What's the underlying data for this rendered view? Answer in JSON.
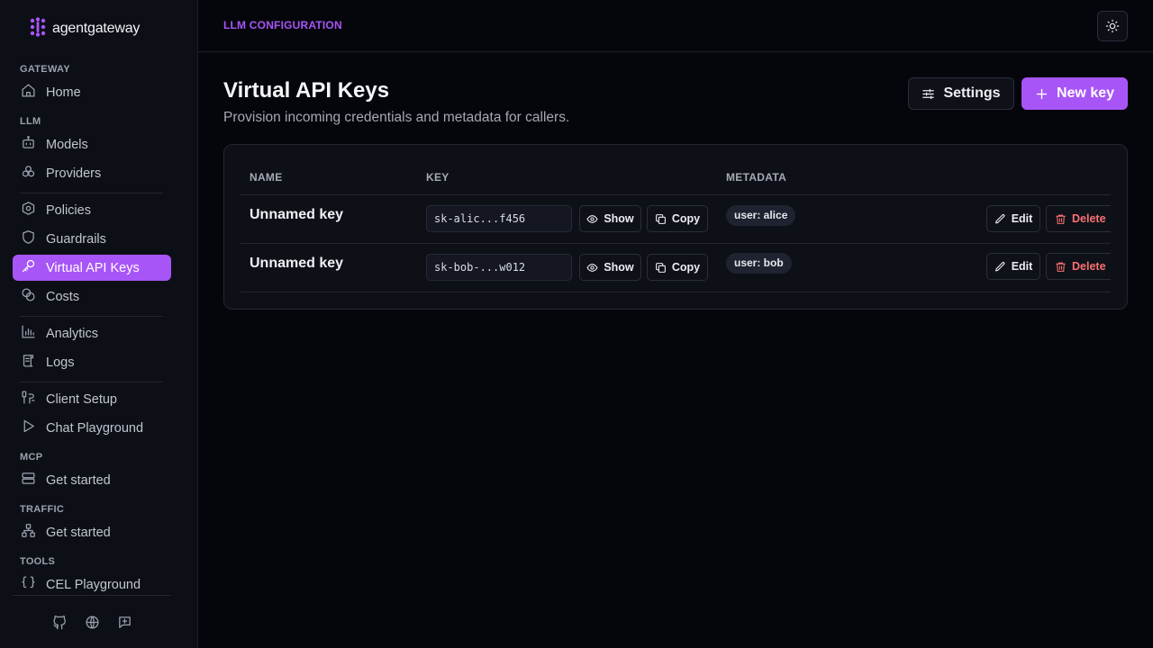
{
  "brand": {
    "name": "agentgateway"
  },
  "sidebar": {
    "sections": {
      "gateway": "GATEWAY",
      "llm": "LLM",
      "mcp": "MCP",
      "traffic": "TRAFFIC",
      "tools": "TOOLS"
    },
    "items": {
      "home": "Home",
      "models": "Models",
      "providers": "Providers",
      "policies": "Policies",
      "guardrails": "Guardrails",
      "virtual_api_keys": "Virtual API Keys",
      "costs": "Costs",
      "analytics": "Analytics",
      "logs": "Logs",
      "client_setup": "Client Setup",
      "chat_playground": "Chat Playground",
      "mcp_get_started": "Get started",
      "traffic_get_started": "Get started",
      "cel_playground": "CEL Playground"
    },
    "active": "virtual_api_keys"
  },
  "header": {
    "breadcrumb": "LLM CONFIGURATION"
  },
  "page": {
    "title": "Virtual API Keys",
    "subtitle": "Provision incoming credentials and metadata for callers.",
    "settings_label": "Settings",
    "new_key_label": "New key"
  },
  "table": {
    "columns": {
      "name": "NAME",
      "key": "KEY",
      "metadata": "METADATA"
    },
    "rows": [
      {
        "name": "Unnamed key",
        "key": "sk-alic...f456",
        "metadata": "user: alice",
        "show": "Show",
        "copy": "Copy",
        "edit": "Edit",
        "delete": "Delete"
      },
      {
        "name": "Unnamed key",
        "key": "sk-bob-...w012",
        "metadata": "user: bob",
        "show": "Show",
        "copy": "Copy",
        "edit": "Edit",
        "delete": "Delete"
      }
    ]
  },
  "colors": {
    "accent": "#a855f7",
    "danger": "#f87171",
    "background": "#05060c",
    "sidebar": "#0d0f17"
  },
  "icons": [
    "agentgateway-logo-icon",
    "home-icon",
    "bot-icon",
    "providers-icon",
    "policies-icon",
    "shield-icon",
    "key-icon",
    "coins-icon",
    "chart-icon",
    "scroll-icon",
    "setup-icon",
    "play-icon",
    "server-icon",
    "network-icon",
    "braces-icon",
    "github-icon",
    "globe-icon",
    "feedback-icon",
    "sun-icon",
    "sliders-icon",
    "plus-icon",
    "eye-icon",
    "copy-icon",
    "pencil-icon",
    "trash-icon"
  ]
}
